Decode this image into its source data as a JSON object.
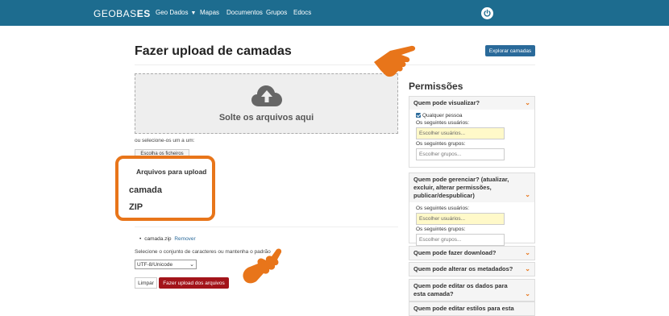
{
  "navbar": {
    "brand_part1": "GEOBAS",
    "brand_part2": "ES",
    "items": [
      "Geo Dados",
      "Mapas",
      "Documentos",
      "Grupos",
      "Edocs"
    ]
  },
  "page": {
    "title": "Fazer upload de camadas",
    "explore_button": "Explorar camadas"
  },
  "dropzone": {
    "text": "Solte os arquivos aqui",
    "or_select": "ou selecione-os um a um:",
    "choose_button": "Escolha os ficheiros"
  },
  "upload_list": {
    "title": "Arquivos para upload",
    "items": [
      "camada",
      "ZIP"
    ]
  },
  "files": {
    "filename": "camada.zip",
    "remove": "Remover"
  },
  "charset": {
    "label": "Selecione o conjunto de caracteres ou mantenha o padrão",
    "value": "UTF-8/Unicode"
  },
  "actions": {
    "clear": "Limpar",
    "upload": "Fazer upload dos arquivos"
  },
  "permissions": {
    "title": "Permissões",
    "view": {
      "heading": "Quem pode visualizar?",
      "anyone": "Qualquer pessoa",
      "users_label": "Os seguintes usuários:",
      "users_placeholder": "Escolher usuários...",
      "groups_label": "Os seguintes grupos:",
      "groups_placeholder": "Escolher grupos..."
    },
    "manage": {
      "heading": "Quem pode gerenciar? (atualizar, excluir, alterar permissões, publicar/despublicar)",
      "users_label": "Os seguintes usuários:",
      "users_placeholder": "Escolher usuários...",
      "groups_label": "Os seguintes grupos:",
      "groups_placeholder": "Escolher grupos..."
    },
    "download": "Quem pode fazer download?",
    "metadata": "Quem pode alterar os metadados?",
    "edit_data": "Quem pode editar os dados para esta camada?",
    "edit_styles": "Quem pode editar estilos para esta"
  },
  "colors": {
    "navbar": "#1d6c8f",
    "accent_orange": "#e8751a",
    "upload_button": "#a3141a",
    "explore_button": "#2a6a9a"
  }
}
